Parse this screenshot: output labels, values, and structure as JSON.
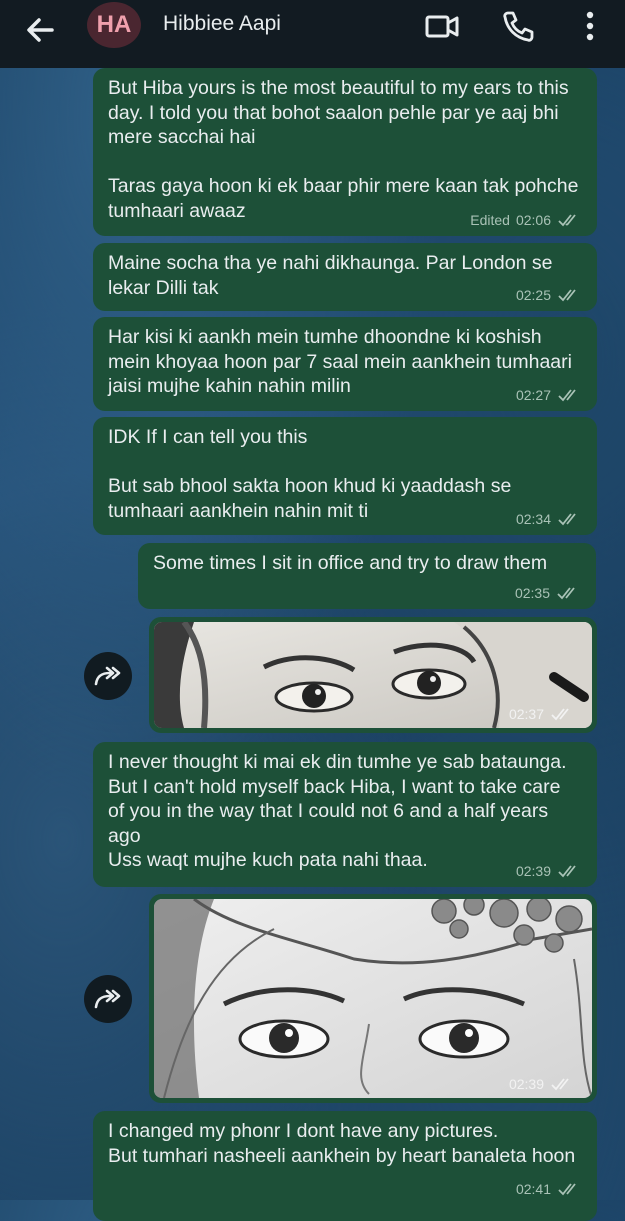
{
  "header": {
    "avatar_initials": "HA",
    "contact_name": "Hibbiee Aapi",
    "icons": [
      "back-arrow-icon",
      "video-call-icon",
      "phone-icon",
      "more-options-icon"
    ]
  },
  "messages": [
    {
      "text": "But Hiba yours is the most beautiful to my ears to this day. I told you that bohot saalon pehle par ye aaj bhi mere sacchai hai\n\nTaras gaya hoon ki ek baar phir mere kaan tak pohche tumhaari awaaz",
      "edited": "Edited",
      "time": "02:06"
    },
    {
      "text": "Maine socha tha ye nahi dikhaunga. Par London se lekar Dilli tak",
      "time": "02:25"
    },
    {
      "text": "Har kisi ki aankh mein tumhe dhoondne ki koshish mein khoyaa hoon par 7 saal mein aankhein tumhaari jaisi mujhe kahin nahin milin",
      "time": "02:27"
    },
    {
      "text": "IDK If I can tell you this\n\nBut sab bhool sakta hoon khud ki yaaddash se tumhaari aankhein nahin mit ti",
      "time": "02:34"
    },
    {
      "text": "Some times I sit in office and try to draw them",
      "time": "02:35"
    },
    {
      "image": "pencil-sketch-of-eyes",
      "time": "02:37"
    },
    {
      "text": "I never thought ki mai ek din tumhe ye sab bataunga. But I can't hold myself back Hiba, I want to take care of you in the way that I could not 6 and a half years ago\nUss waqt mujhe kuch pata nahi thaa.",
      "time": "02:39"
    },
    {
      "image": "pencil-sketch-of-eyes-with-flowers",
      "time": "02:39"
    },
    {
      "text": "I changed my phonr I dont have any pictures.\nBut tumhari nasheeli aankhein by heart banaleta hoon",
      "time": "02:41"
    }
  ],
  "colors": {
    "header": "#121b22",
    "bubble": "#1d5038",
    "text": "#e9edef"
  }
}
